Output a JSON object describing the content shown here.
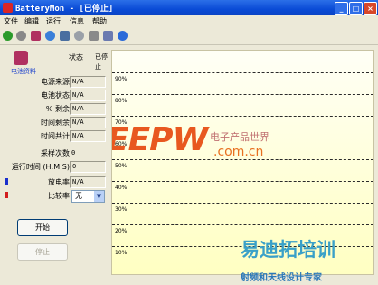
{
  "window": {
    "title": "BatteryMon - [已停止]"
  },
  "menu": [
    "文件",
    "编辑",
    "运行",
    "信息",
    "帮助"
  ],
  "toolbar": {
    "icons": [
      "start-icon",
      "stop-icon",
      "battery-icon",
      "info-icon",
      "document-icon",
      "cloud-icon",
      "tools-icon",
      "settings-icon",
      "help-icon"
    ],
    "colors": [
      "#2a9a2a",
      "#888888",
      "#b03060",
      "#3a7fd9",
      "#4a6fa0",
      "#9aa0a8",
      "#8a8a8a",
      "#6a7ab0",
      "#2a6ad9"
    ]
  },
  "left_panel": {
    "battery_link": "电池资料",
    "status_label": "状态",
    "status_value": "已停止",
    "fields": [
      {
        "label": "电源来源",
        "value": "N/A"
      },
      {
        "label": "电池状态",
        "value": "N/A"
      },
      {
        "label": "% 剩余",
        "value": "N/A"
      },
      {
        "label": "时间剩余",
        "value": "N/A"
      },
      {
        "label": "时间共计",
        "value": "N/A"
      }
    ],
    "sample_count_label": "采样次数",
    "sample_count_value": "0",
    "run_time_label": "运行时间 (H:M:S)",
    "run_time_value": "0",
    "rate_label": "放电率",
    "rate_value": "N/A",
    "compare_label": "比较率",
    "compare_value": "无",
    "start_button": "开始",
    "stop_button": "停止",
    "marker_colors": {
      "rate": "#1a2fcc",
      "compare": "#d21e1e"
    }
  },
  "chart": {
    "gridlines": [
      "90%",
      "80%",
      "70%",
      "60%",
      "50%",
      "40%",
      "30%",
      "20%",
      "10%"
    ]
  },
  "watermarks": {
    "eepw": "EEPW",
    "eepw_cn": "电子产品世界",
    "eepw_url": ".com.cn",
    "brand": "易迪拓培训",
    "tagline": "射频和天线设计专家"
  }
}
